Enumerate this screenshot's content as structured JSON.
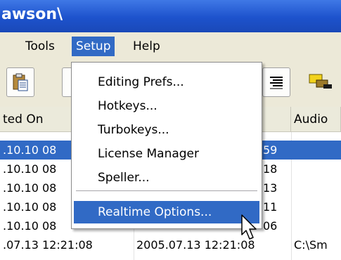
{
  "window": {
    "title_fragment": "awson\\"
  },
  "menubar": {
    "items": [
      {
        "label": "Tools"
      },
      {
        "label": "Setup"
      },
      {
        "label": "Help"
      }
    ]
  },
  "setup_menu": {
    "items": [
      {
        "label": "Editing Prefs..."
      },
      {
        "label": "Hotkeys..."
      },
      {
        "label": "Turbokeys..."
      },
      {
        "label": "License Manager"
      },
      {
        "label": "Speller..."
      },
      {
        "label": "Realtime Options..."
      }
    ]
  },
  "grid": {
    "columns": [
      {
        "label": "ted On"
      },
      {
        "label": ""
      },
      {
        "label": "Audio"
      }
    ],
    "rows": [
      {
        "col1": ".10.10 08",
        "col2": "59",
        "col3": ""
      },
      {
        "col1": ".10.10 08",
        "col2": "18",
        "col3": ""
      },
      {
        "col1": ".10.10 08",
        "col2": "13",
        "col3": ""
      },
      {
        "col1": ".10.10 08",
        "col2": "11",
        "col3": ""
      },
      {
        "col1": ".10.10 08",
        "col2": "06",
        "col3": ""
      },
      {
        "col1": ".07.13 12:21:08",
        "col2": "2005.07.13 12:21:08",
        "col3": "C:\\Sm"
      }
    ]
  },
  "colors": {
    "selection": "#316ac5",
    "titlebar": "#1d52cc"
  }
}
